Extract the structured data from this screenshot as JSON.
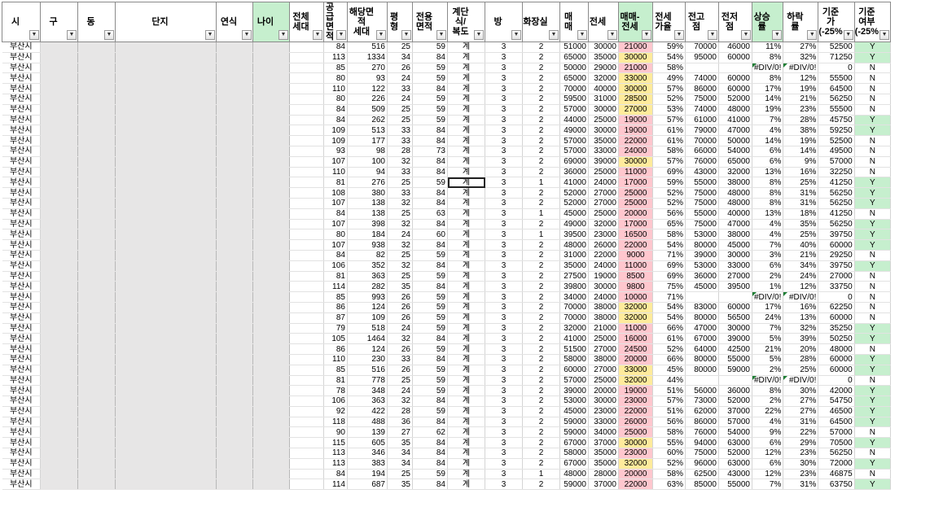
{
  "colors": {
    "pink": "#ffc7ce",
    "yellow": "#ffeb9c",
    "green": "#c6efce",
    "gray": "#e7e6e6"
  },
  "headers": [
    {
      "label": "시",
      "green": false
    },
    {
      "label": "구",
      "green": false
    },
    {
      "label": "동",
      "green": false
    },
    {
      "label": "단지",
      "green": false
    },
    {
      "label": "연식",
      "green": false
    },
    {
      "label": "나이",
      "green": true
    },
    {
      "label": "전체\n세대",
      "green": false
    },
    {
      "label": "공급 면적",
      "green": false
    },
    {
      "label": "해당면적\n세대",
      "green": false
    },
    {
      "label": "평형",
      "green": false
    },
    {
      "label": "전용면적",
      "green": false
    },
    {
      "label": "계단식/\n복도",
      "green": false
    },
    {
      "label": "방",
      "green": false
    },
    {
      "label": "화장실",
      "green": false
    },
    {
      "label": "매매",
      "green": false
    },
    {
      "label": "전세",
      "green": false
    },
    {
      "label": "매매-전세",
      "green": true
    },
    {
      "label": "전세가율",
      "green": false
    },
    {
      "label": "전고점",
      "green": false
    },
    {
      "label": "전저점",
      "green": false
    },
    {
      "label": "상승률",
      "green": true
    },
    {
      "label": "하락률",
      "green": false
    },
    {
      "label": "기준가\n(-25%",
      "green": false
    },
    {
      "label": "기준여부\n(-25%",
      "green": false
    }
  ],
  "rows": [
    [
      "부산시",
      "84",
      "516",
      "25",
      "59",
      "계",
      "3",
      "2",
      "51000",
      "30000",
      "21000",
      "59%",
      "70000",
      "46000",
      "11%",
      "27%",
      "52500",
      "Y"
    ],
    [
      "부산시",
      "113",
      "1334",
      "34",
      "84",
      "계",
      "3",
      "2",
      "65000",
      "35000",
      "30000",
      "54%",
      "95000",
      "60000",
      "8%",
      "32%",
      "71250",
      "Y"
    ],
    [
      "부산시",
      "85",
      "270",
      "26",
      "59",
      "계",
      "3",
      "2",
      "50000",
      "29000",
      "21000",
      "58%",
      "",
      "",
      "#DIV/0!",
      "#DIV/0!",
      "0",
      "N"
    ],
    [
      "부산시",
      "80",
      "93",
      "24",
      "59",
      "계",
      "3",
      "2",
      "65000",
      "32000",
      "33000",
      "49%",
      "74000",
      "60000",
      "8%",
      "12%",
      "55500",
      "N"
    ],
    [
      "부산시",
      "110",
      "122",
      "33",
      "84",
      "계",
      "3",
      "2",
      "70000",
      "40000",
      "30000",
      "57%",
      "86000",
      "60000",
      "17%",
      "19%",
      "64500",
      "N"
    ],
    [
      "부산시",
      "80",
      "226",
      "24",
      "59",
      "계",
      "3",
      "2",
      "59500",
      "31000",
      "28500",
      "52%",
      "75000",
      "52000",
      "14%",
      "21%",
      "56250",
      "N"
    ],
    [
      "부산시",
      "84",
      "509",
      "25",
      "59",
      "계",
      "3",
      "2",
      "57000",
      "30000",
      "27000",
      "53%",
      "74000",
      "48000",
      "19%",
      "23%",
      "55500",
      "N"
    ],
    [
      "부산시",
      "84",
      "262",
      "25",
      "59",
      "계",
      "3",
      "2",
      "44000",
      "25000",
      "19000",
      "57%",
      "61000",
      "41000",
      "7%",
      "28%",
      "45750",
      "Y"
    ],
    [
      "부산시",
      "109",
      "513",
      "33",
      "84",
      "계",
      "3",
      "2",
      "49000",
      "30000",
      "19000",
      "61%",
      "79000",
      "47000",
      "4%",
      "38%",
      "59250",
      "Y"
    ],
    [
      "부산시",
      "109",
      "177",
      "33",
      "84",
      "계",
      "3",
      "2",
      "57000",
      "35000",
      "22000",
      "61%",
      "70000",
      "50000",
      "14%",
      "19%",
      "52500",
      "N"
    ],
    [
      "부산시",
      "93",
      "98",
      "28",
      "73",
      "계",
      "3",
      "2",
      "57000",
      "33000",
      "24000",
      "58%",
      "66000",
      "54000",
      "6%",
      "14%",
      "49500",
      "N"
    ],
    [
      "부산시",
      "107",
      "100",
      "32",
      "84",
      "계",
      "3",
      "2",
      "69000",
      "39000",
      "30000",
      "57%",
      "76000",
      "65000",
      "6%",
      "9%",
      "57000",
      "N"
    ],
    [
      "부산시",
      "110",
      "94",
      "33",
      "84",
      "계",
      "3",
      "2",
      "36000",
      "25000",
      "11000",
      "69%",
      "43000",
      "32000",
      "13%",
      "16%",
      "32250",
      "N"
    ],
    [
      "부산시",
      "81",
      "276",
      "25",
      "59",
      "계",
      "3",
      "1",
      "41000",
      "24000",
      "17000",
      "59%",
      "55000",
      "38000",
      "8%",
      "25%",
      "41250",
      "Y"
    ],
    [
      "부산시",
      "108",
      "380",
      "33",
      "84",
      "계",
      "3",
      "2",
      "52000",
      "27000",
      "25000",
      "52%",
      "75000",
      "48000",
      "8%",
      "31%",
      "56250",
      "Y"
    ],
    [
      "부산시",
      "107",
      "138",
      "32",
      "84",
      "계",
      "3",
      "2",
      "52000",
      "27000",
      "25000",
      "52%",
      "75000",
      "48000",
      "8%",
      "31%",
      "56250",
      "Y"
    ],
    [
      "부산시",
      "84",
      "138",
      "25",
      "63",
      "계",
      "3",
      "1",
      "45000",
      "25000",
      "20000",
      "56%",
      "55000",
      "40000",
      "13%",
      "18%",
      "41250",
      "N"
    ],
    [
      "부산시",
      "107",
      "398",
      "32",
      "84",
      "계",
      "3",
      "2",
      "49000",
      "32000",
      "17000",
      "65%",
      "75000",
      "47000",
      "4%",
      "35%",
      "56250",
      "Y"
    ],
    [
      "부산시",
      "80",
      "184",
      "24",
      "60",
      "계",
      "3",
      "1",
      "39500",
      "23000",
      "16500",
      "58%",
      "53000",
      "38000",
      "4%",
      "25%",
      "39750",
      "Y"
    ],
    [
      "부산시",
      "107",
      "938",
      "32",
      "84",
      "계",
      "3",
      "2",
      "48000",
      "26000",
      "22000",
      "54%",
      "80000",
      "45000",
      "7%",
      "40%",
      "60000",
      "Y"
    ],
    [
      "부산시",
      "84",
      "82",
      "25",
      "59",
      "계",
      "3",
      "2",
      "31000",
      "22000",
      "9000",
      "71%",
      "39000",
      "30000",
      "3%",
      "21%",
      "29250",
      "N"
    ],
    [
      "부산시",
      "106",
      "352",
      "32",
      "84",
      "계",
      "3",
      "2",
      "35000",
      "24000",
      "11000",
      "69%",
      "53000",
      "33000",
      "6%",
      "34%",
      "39750",
      "Y"
    ],
    [
      "부산시",
      "81",
      "363",
      "25",
      "59",
      "계",
      "3",
      "2",
      "27500",
      "19000",
      "8500",
      "69%",
      "36000",
      "27000",
      "2%",
      "24%",
      "27000",
      "N"
    ],
    [
      "부산시",
      "114",
      "282",
      "35",
      "84",
      "계",
      "3",
      "2",
      "39800",
      "30000",
      "9800",
      "75%",
      "45000",
      "39500",
      "1%",
      "12%",
      "33750",
      "N"
    ],
    [
      "부산시",
      "85",
      "993",
      "26",
      "59",
      "계",
      "3",
      "2",
      "34000",
      "24000",
      "10000",
      "71%",
      "",
      "",
      "#DIV/0!",
      "#DIV/0!",
      "0",
      "N"
    ],
    [
      "부산시",
      "86",
      "124",
      "26",
      "59",
      "계",
      "3",
      "2",
      "70000",
      "38000",
      "32000",
      "54%",
      "83000",
      "60000",
      "17%",
      "16%",
      "62250",
      "N"
    ],
    [
      "부산시",
      "87",
      "109",
      "26",
      "59",
      "계",
      "3",
      "2",
      "70000",
      "38000",
      "32000",
      "54%",
      "80000",
      "56500",
      "24%",
      "13%",
      "60000",
      "N"
    ],
    [
      "부산시",
      "79",
      "518",
      "24",
      "59",
      "계",
      "3",
      "2",
      "32000",
      "21000",
      "11000",
      "66%",
      "47000",
      "30000",
      "7%",
      "32%",
      "35250",
      "Y"
    ],
    [
      "부산시",
      "105",
      "1464",
      "32",
      "84",
      "계",
      "3",
      "2",
      "41000",
      "25000",
      "16000",
      "61%",
      "67000",
      "39000",
      "5%",
      "39%",
      "50250",
      "Y"
    ],
    [
      "부산시",
      "86",
      "124",
      "26",
      "59",
      "계",
      "3",
      "2",
      "51500",
      "27000",
      "24500",
      "52%",
      "64000",
      "42500",
      "21%",
      "20%",
      "48000",
      "N"
    ],
    [
      "부산시",
      "110",
      "230",
      "33",
      "84",
      "계",
      "3",
      "2",
      "58000",
      "38000",
      "20000",
      "66%",
      "80000",
      "55000",
      "5%",
      "28%",
      "60000",
      "Y"
    ],
    [
      "부산시",
      "85",
      "516",
      "26",
      "59",
      "계",
      "3",
      "2",
      "60000",
      "27000",
      "33000",
      "45%",
      "80000",
      "59000",
      "2%",
      "25%",
      "60000",
      "Y"
    ],
    [
      "부산시",
      "81",
      "778",
      "25",
      "59",
      "계",
      "3",
      "2",
      "57000",
      "25000",
      "32000",
      "44%",
      "",
      "",
      "#DIV/0!",
      "#DIV/0!",
      "0",
      "N"
    ],
    [
      "부산시",
      "78",
      "348",
      "24",
      "59",
      "계",
      "3",
      "2",
      "39000",
      "20000",
      "19000",
      "51%",
      "56000",
      "36000",
      "8%",
      "30%",
      "42000",
      "Y"
    ],
    [
      "부산시",
      "106",
      "363",
      "32",
      "84",
      "계",
      "3",
      "2",
      "53000",
      "30000",
      "23000",
      "57%",
      "73000",
      "52000",
      "2%",
      "27%",
      "54750",
      "Y"
    ],
    [
      "부산시",
      "92",
      "422",
      "28",
      "59",
      "계",
      "3",
      "2",
      "45000",
      "23000",
      "22000",
      "51%",
      "62000",
      "37000",
      "22%",
      "27%",
      "46500",
      "Y"
    ],
    [
      "부산시",
      "118",
      "488",
      "36",
      "84",
      "계",
      "3",
      "2",
      "59000",
      "33000",
      "26000",
      "56%",
      "86000",
      "57000",
      "4%",
      "31%",
      "64500",
      "Y"
    ],
    [
      "부산시",
      "90",
      "139",
      "27",
      "62",
      "계",
      "3",
      "2",
      "59000",
      "34000",
      "25000",
      "58%",
      "76000",
      "54000",
      "9%",
      "22%",
      "57000",
      "N"
    ],
    [
      "부산시",
      "115",
      "605",
      "35",
      "84",
      "계",
      "3",
      "2",
      "67000",
      "37000",
      "30000",
      "55%",
      "94000",
      "63000",
      "6%",
      "29%",
      "70500",
      "Y"
    ],
    [
      "부산시",
      "113",
      "346",
      "34",
      "84",
      "계",
      "3",
      "2",
      "58000",
      "35000",
      "23000",
      "60%",
      "75000",
      "52000",
      "12%",
      "23%",
      "56250",
      "N"
    ],
    [
      "부산시",
      "113",
      "383",
      "34",
      "84",
      "계",
      "3",
      "2",
      "67000",
      "35000",
      "32000",
      "52%",
      "96000",
      "63000",
      "6%",
      "30%",
      "72000",
      "Y"
    ],
    [
      "부산시",
      "84",
      "194",
      "25",
      "59",
      "계",
      "3",
      "1",
      "48000",
      "28000",
      "20000",
      "58%",
      "62500",
      "43000",
      "12%",
      "23%",
      "46875",
      "N"
    ],
    [
      "부산시",
      "114",
      "687",
      "35",
      "84",
      "계",
      "3",
      "2",
      "59000",
      "37000",
      "22000",
      "63%",
      "85000",
      "55000",
      "7%",
      "31%",
      "63750",
      "Y"
    ]
  ]
}
